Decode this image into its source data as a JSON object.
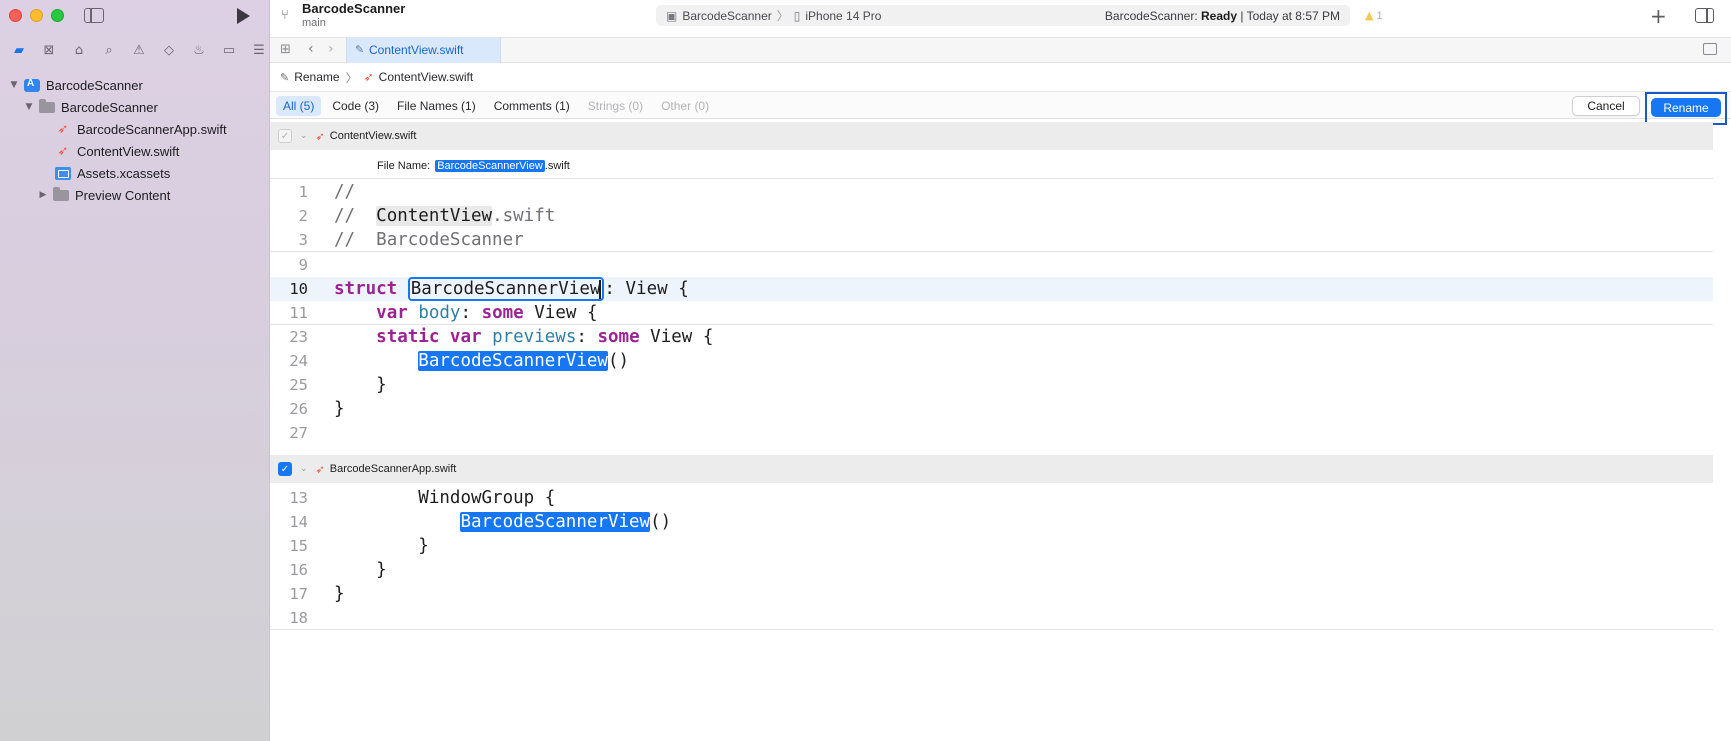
{
  "window": {
    "project_name": "BarcodeScanner",
    "branch": "main",
    "scheme_target": "BarcodeScanner",
    "scheme_device": "iPhone 14 Pro",
    "status_prefix": "BarcodeScanner:",
    "status_state": "Ready",
    "status_time": "| Today at 8:57 PM",
    "warning_count": "1",
    "add_label": "+"
  },
  "navigator": {
    "tree": [
      {
        "label": "BarcodeScanner",
        "type": "project",
        "expanded": true
      },
      {
        "label": "BarcodeScanner",
        "type": "folder",
        "expanded": true
      },
      {
        "label": "BarcodeScannerApp.swift",
        "type": "swift"
      },
      {
        "label": "ContentView.swift",
        "type": "swift"
      },
      {
        "label": "Assets.xcassets",
        "type": "assets"
      },
      {
        "label": "Preview Content",
        "type": "folder",
        "expanded": false
      }
    ]
  },
  "tabbar": {
    "active_tab": "ContentView.swift"
  },
  "breadcrumb": {
    "root": "Rename",
    "file": "ContentView.swift"
  },
  "filters": [
    {
      "label": "All (5)",
      "state": "active"
    },
    {
      "label": "Code (3)",
      "state": "normal"
    },
    {
      "label": "File Names (1)",
      "state": "normal"
    },
    {
      "label": "Comments (1)",
      "state": "normal"
    },
    {
      "label": "Strings (0)",
      "state": "disabled"
    },
    {
      "label": "Other (0)",
      "state": "disabled"
    }
  ],
  "actions": {
    "cancel": "Cancel",
    "rename": "Rename"
  },
  "files": [
    {
      "name": "ContentView.swift",
      "checked": false,
      "file_name_label": "File Name:",
      "file_name_new": "BarcodeScannerView",
      "file_name_ext": ".swift"
    },
    {
      "name": "BarcodeScannerApp.swift",
      "checked": true
    }
  ],
  "code": {
    "comment_marker": "//",
    "old_name": "ContentView",
    "old_name_ext": ".swift",
    "project_comment": "BarcodeScanner",
    "new_name": "BarcodeScannerView",
    "kw_struct": "struct",
    "kw_var": "var",
    "kw_some": "some",
    "kw_static": "static",
    "prop_body": "body",
    "prop_previews": "previews",
    "type_view": "View",
    "window_group": "WindowGroup",
    "open_brace": "{",
    "close_brace": "}",
    "call_parens": "()",
    "colon": ":",
    "line_numbers_a": [
      "1",
      "2",
      "3",
      "9",
      "10",
      "11",
      "23",
      "24",
      "25",
      "26",
      "27"
    ],
    "line_numbers_b": [
      "13",
      "14",
      "15",
      "16",
      "17",
      "18"
    ]
  },
  "colors": {
    "accent": "#1676f3",
    "keyword": "#9b2393",
    "property": "#2f7fa3",
    "swift_icon": "#f05138"
  }
}
